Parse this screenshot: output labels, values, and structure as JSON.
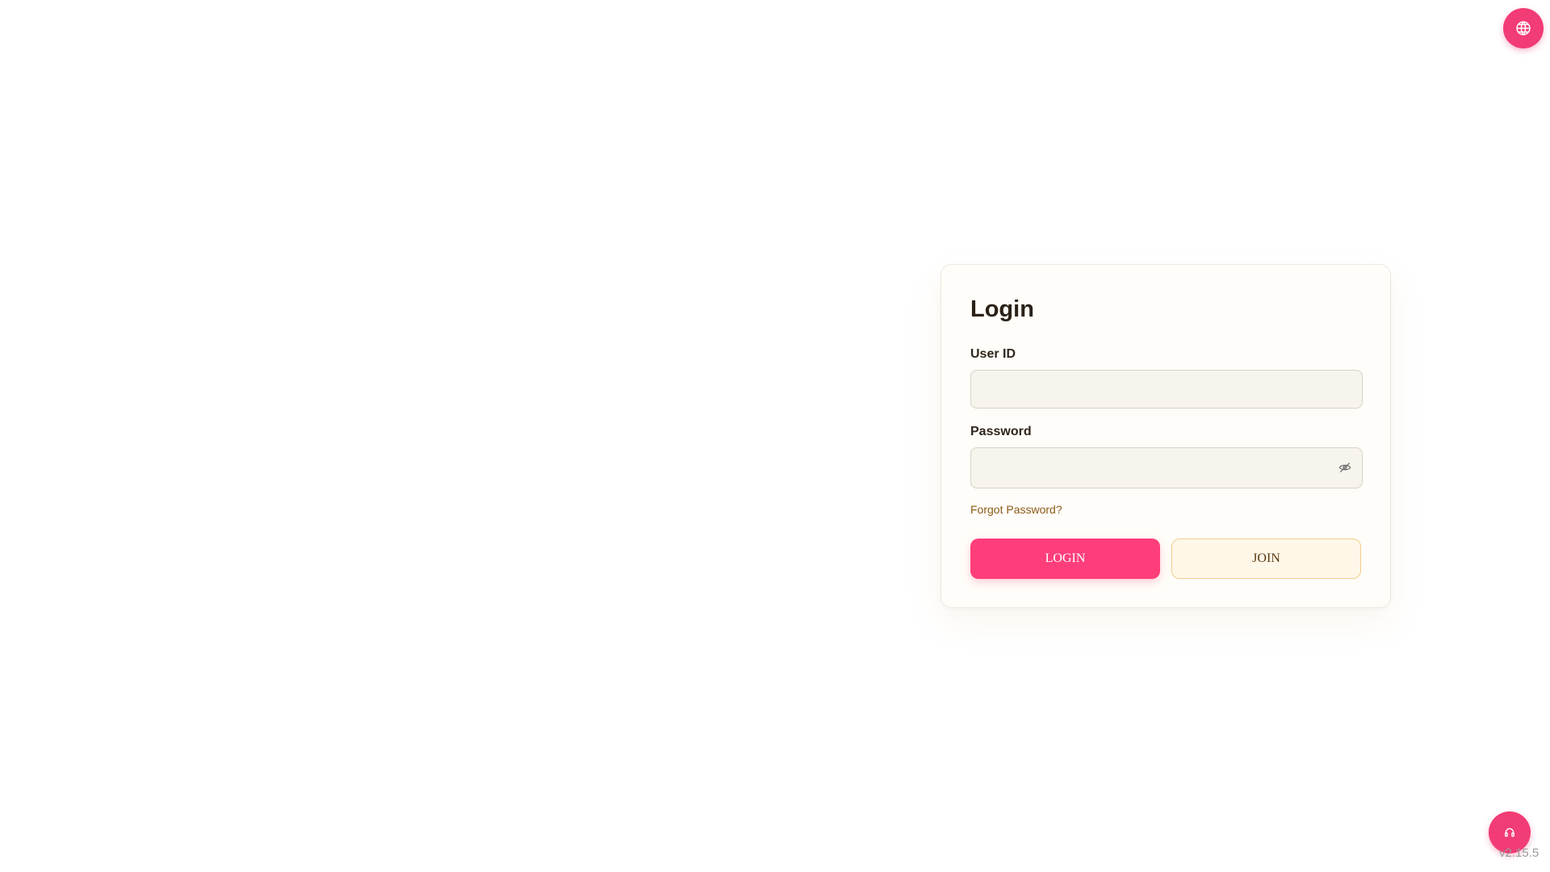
{
  "header": {
    "language_icon": "globe-icon"
  },
  "login": {
    "title": "Login",
    "user_id": {
      "label": "User ID",
      "value": "",
      "placeholder": ""
    },
    "password": {
      "label": "Password",
      "value": "",
      "placeholder": "",
      "toggle_icon": "eye-off-icon"
    },
    "forgot_label": "Forgot Password?",
    "login_label": "LOGIN",
    "join_label": "JOIN"
  },
  "footer": {
    "support_icon": "headset-icon",
    "version": "v2.15.5"
  },
  "colors": {
    "accent": "#f23c75",
    "login_button": "#fe3e7a",
    "join_button_bg": "#fff7e8",
    "join_button_border": "#f1cd8e",
    "link": "#8b5a17"
  }
}
